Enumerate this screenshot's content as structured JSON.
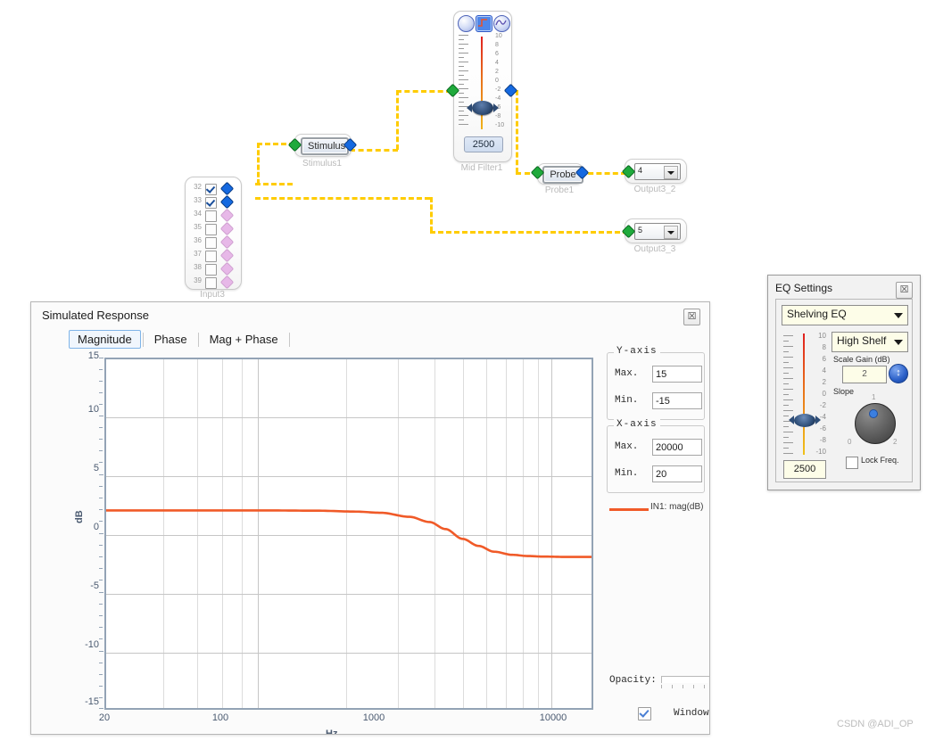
{
  "schematic": {
    "input_block": {
      "name": "Input3",
      "rows": [
        {
          "num": "32",
          "checked": true
        },
        {
          "num": "33",
          "checked": true
        },
        {
          "num": "34",
          "checked": false
        },
        {
          "num": "35",
          "checked": false
        },
        {
          "num": "36",
          "checked": false
        },
        {
          "num": "37",
          "checked": false
        },
        {
          "num": "38",
          "checked": false
        },
        {
          "num": "39",
          "checked": false
        }
      ]
    },
    "stimulus": {
      "button_label": "Stimulus",
      "name": "Stimulus1"
    },
    "mid_filter": {
      "name": "Mid Filter1",
      "freq_value": "2500",
      "scale_labels": [
        "10",
        "8",
        "6",
        "4",
        "2",
        "0",
        "-2",
        "-4",
        "-6",
        "-8",
        "-10"
      ],
      "icons": [
        "target-icon",
        "filter-curve-icon",
        "sine-wave-icon"
      ]
    },
    "probe": {
      "button_label": "Probe",
      "name": "Probe1"
    },
    "outputs": [
      {
        "value": "4",
        "name": "Output3_2"
      },
      {
        "value": "5",
        "name": "Output3_3"
      }
    ]
  },
  "response_window": {
    "title": "Simulated Response",
    "close_label": "☒",
    "tabs": [
      {
        "label": "Magnitude",
        "active": true
      },
      {
        "label": "Phase",
        "active": false
      },
      {
        "label": "Mag + Phase",
        "active": false
      }
    ],
    "y_axis": {
      "legend": "Y-axis",
      "max_label": "Max.",
      "max_value": "15",
      "min_label": "Min.",
      "min_value": "-15"
    },
    "x_axis": {
      "legend": "X-axis",
      "max_label": "Max.",
      "max_value": "20000",
      "min_label": "Min.",
      "min_value": "20"
    },
    "legend_entry": "IN1: mag(dB)",
    "opacity_label": "Opacity:",
    "window_on_top_label": "Window On Top",
    "window_on_top_checked": true
  },
  "chart_data": {
    "type": "line",
    "title": "Simulated Response",
    "xlabel": "Hz",
    "ylabel": "dB",
    "xscale": "log",
    "xlim": [
      20,
      20000
    ],
    "ylim": [
      -15,
      15
    ],
    "xticks": [
      20,
      100,
      1000,
      10000
    ],
    "xtick_labels": [
      "20",
      "100",
      "1000",
      "10000"
    ],
    "yticks": [
      -15,
      -10,
      -5,
      0,
      5,
      10,
      15
    ],
    "ytick_labels": [
      "-15",
      "-10",
      "-5",
      "0",
      "5",
      "10",
      "15"
    ],
    "grid": true,
    "legend_position": "right",
    "series": [
      {
        "name": "IN1: mag(dB)",
        "color": "#f05a28",
        "x": [
          20,
          50,
          100,
          200,
          400,
          700,
          1000,
          1500,
          2000,
          2500,
          3200,
          4000,
          5000,
          6500,
          8000,
          10000,
          14000,
          20000
        ],
        "y": [
          2.0,
          2.0,
          2.0,
          2.0,
          1.98,
          1.9,
          1.8,
          1.45,
          1.0,
          0.4,
          -0.45,
          -1.05,
          -1.55,
          -1.82,
          -1.92,
          -1.97,
          -2.0,
          -2.0
        ]
      }
    ]
  },
  "eq_settings": {
    "title": "EQ Settings",
    "close_label": "☒",
    "eq_type": "Shelving EQ",
    "shelf_type": "High Shelf",
    "scale_gain_label": "Scale Gain (dB)",
    "scale_gain_value": "2",
    "gain_button_glyph": "↕",
    "slope_label": "Slope",
    "slope_ticks": [
      "0",
      "1",
      "2"
    ],
    "freq_value": "2500",
    "lock_freq_label": "Lock Freq.",
    "lock_freq_checked": false,
    "slider_labels": [
      "10",
      "8",
      "6",
      "4",
      "2",
      "0",
      "-2",
      "-4",
      "-6",
      "-8",
      "-10"
    ]
  },
  "watermark": "CSDN @ADI_OP",
  "colors": {
    "curve": "#f05a28",
    "wire": "#ffcc00",
    "accent_blue": "#1569e0",
    "port_green": "#1faa3c"
  }
}
